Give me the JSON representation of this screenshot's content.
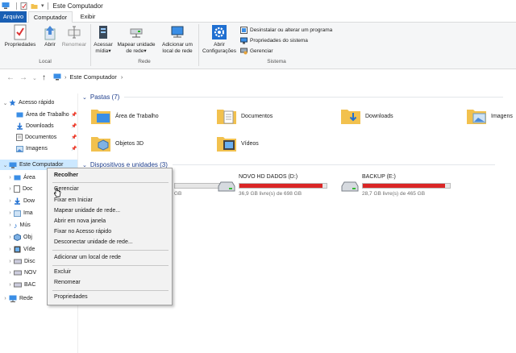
{
  "window": {
    "title": "Este Computador"
  },
  "tabs": {
    "file": "Arquivo",
    "computer": "Computador",
    "view": "Exibir"
  },
  "ribbon": {
    "properties": "Propriedades",
    "open": "Abrir",
    "rename": "Renomear",
    "access_media_1": "Acessar",
    "access_media_2": "mídia",
    "map_drive_1": "Mapear unidade",
    "map_drive_2": "de rede",
    "add_location_1": "Adicionar um",
    "add_location_2": "local de rede",
    "settings_1": "Abrir",
    "settings_2": "Configurações",
    "uninstall": "Desinstalar ou alterar um programa",
    "system_props": "Propriedades do sistema",
    "manage": "Gerenciar",
    "group_local": "Local",
    "group_network": "Rede",
    "group_system": "Sistema"
  },
  "address": {
    "path": "Este Computador"
  },
  "nav": {
    "quick_access": "Acesso rápido",
    "quick": [
      "Área de Trabalho",
      "Downloads",
      "Documentos",
      "Imagens"
    ],
    "this_pc": "Este Computador",
    "pc_children": [
      "Área",
      "Doc",
      "Dow",
      "Ima",
      "Mús",
      "Obj",
      "Víde",
      "Disc",
      "NOV",
      "BAC"
    ],
    "network": "Rede"
  },
  "content": {
    "folders_header": "Pastas (7)",
    "folders": [
      "Área de Trabalho",
      "Documentos",
      "Downloads",
      "Imagens",
      "Objetos 3D",
      "Vídeos"
    ],
    "devices_header": "Dispositivos e unidades (3)",
    "drives": [
      {
        "name": "NOVO HD DADOS (D:)",
        "free": "36,9 GB livre(s) de 698 GB",
        "used_fraction": 0.95
      },
      {
        "name": "BACKUP (E:)",
        "free": "28,7 GB livre(s) de 465 GB",
        "used_fraction": 0.94
      }
    ],
    "drive_c_free": "GB"
  },
  "context_menu": {
    "collapse": "Recolher",
    "manage": "Gerenciar",
    "pin_start": "Fixar em Iniciar",
    "map_drive": "Mapear unidade de rede...",
    "open_new_window": "Abrir em nova janela",
    "pin_quick": "Fixar no Acesso rápido",
    "disconnect": "Desconectar unidade de rede...",
    "add_location": "Adicionar um local de rede",
    "delete": "Excluir",
    "rename": "Renomear",
    "properties": "Propriedades"
  },
  "colors": {
    "accent": "#1a5fb4",
    "drive_full": "#da2626",
    "folder": "#f2c14e",
    "selection": "#cce8ff"
  }
}
